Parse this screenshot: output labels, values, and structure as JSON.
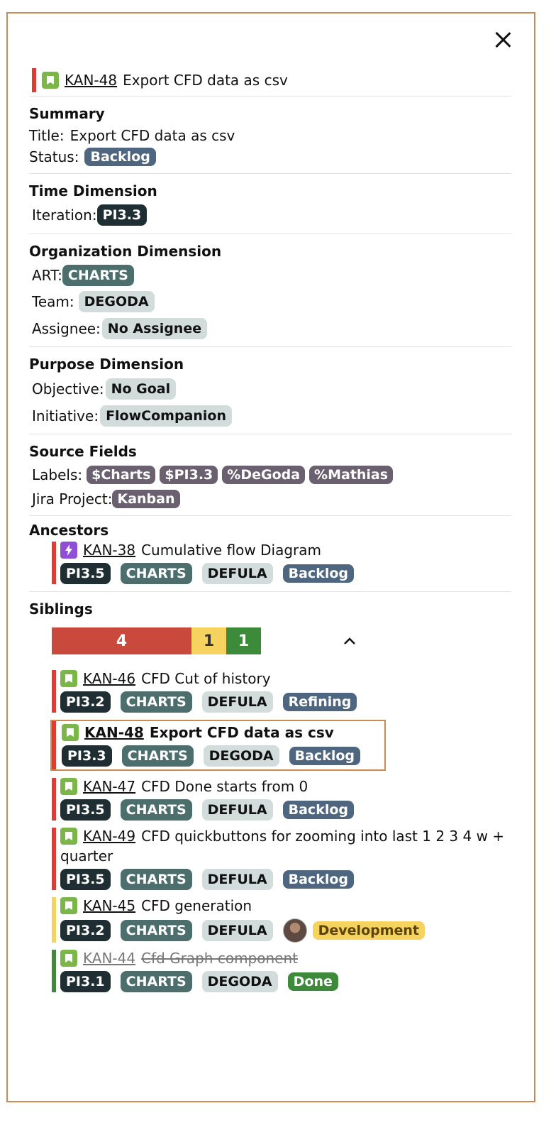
{
  "header": {
    "key": "KAN-48",
    "title": "Export CFD data as csv"
  },
  "summary": {
    "section": "Summary",
    "title_label": "Title:",
    "title_value": "Export CFD data as csv",
    "status_label": "Status:",
    "status_value": "Backlog"
  },
  "time": {
    "section": "Time Dimension",
    "iteration_label": "Iteration:",
    "iteration_value": "PI3.3"
  },
  "org": {
    "section": "Organization Dimension",
    "art_label": "ART:",
    "art_value": "CHARTS",
    "team_label": "Team:",
    "team_value": "DEGODA",
    "assignee_label": "Assignee:",
    "assignee_value": "No Assignee"
  },
  "purpose": {
    "section": "Purpose Dimension",
    "objective_label": "Objective:",
    "objective_value": "No Goal",
    "initiative_label": "Initiative:",
    "initiative_value": "FlowCompanion"
  },
  "source": {
    "section": "Source Fields",
    "labels_label": "Labels:",
    "labels": [
      "$Charts",
      "$PI3.3",
      "%DeGoda",
      "%Mathias"
    ],
    "project_label": "Jira Project:",
    "project_value": "Kanban"
  },
  "ancestors": {
    "section": "Ancestors",
    "items": [
      {
        "key": "KAN-38",
        "title": "Cumulative flow Diagram",
        "iteration": "PI3.5",
        "art": "CHARTS",
        "team": "DEFULA",
        "status": "Backlog"
      }
    ]
  },
  "siblings": {
    "section": "Siblings",
    "progress": [
      {
        "count": "4",
        "color": "#c94a3d"
      },
      {
        "count": "1",
        "color": "#f6d25e"
      },
      {
        "count": "1",
        "color": "#3d8a3a"
      }
    ],
    "items": [
      {
        "key": "KAN-46",
        "title": "CFD Cut of history",
        "iteration": "PI3.2",
        "art": "CHARTS",
        "team": "DEFULA",
        "status": "Refining"
      },
      {
        "key": "KAN-48",
        "title": "Export CFD data as csv",
        "iteration": "PI3.3",
        "art": "CHARTS",
        "team": "DEGODA",
        "status": "Backlog"
      },
      {
        "key": "KAN-47",
        "title": "CFD Done starts from 0",
        "iteration": "PI3.5",
        "art": "CHARTS",
        "team": "DEFULA",
        "status": "Backlog"
      },
      {
        "key": "KAN-49",
        "title": "CFD quickbuttons for zooming into last 1 2 3 4 w +",
        "title_cont": "quarter",
        "iteration": "PI3.5",
        "art": "CHARTS",
        "team": "DEFULA",
        "status": "Backlog"
      },
      {
        "key": "KAN-45",
        "title": "CFD generation",
        "iteration": "PI3.2",
        "art": "CHARTS",
        "team": "DEFULA",
        "status": "Development"
      },
      {
        "key": "KAN-44",
        "title": "Cfd Graph component",
        "iteration": "PI3.1",
        "art": "CHARTS",
        "team": "DEGODA",
        "status": "Done"
      }
    ]
  },
  "colors": {
    "accent_border": "#cc8a52",
    "todo_bar": "#e8382f",
    "progress_bar": "#f6d25e",
    "done_bar": "#3d8a3a"
  }
}
